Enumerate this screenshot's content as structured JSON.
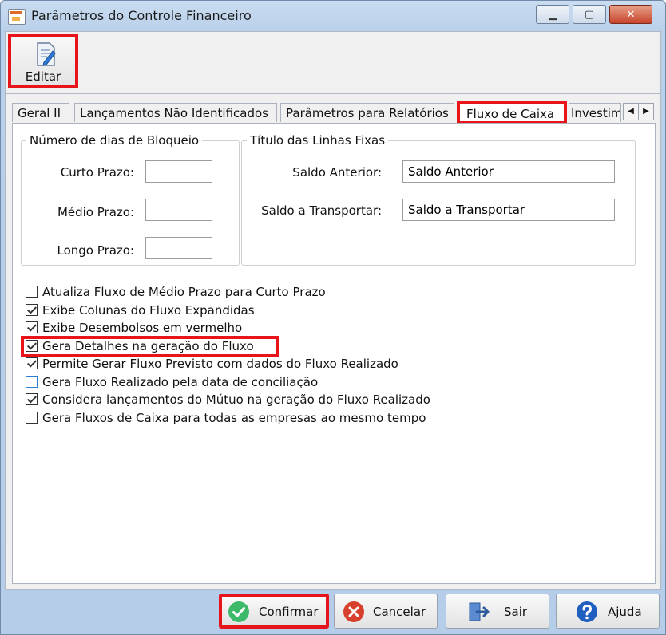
{
  "window": {
    "title": "Parâmetros do Controle Financeiro"
  },
  "toolbar": {
    "edit_label": "Editar"
  },
  "tabs": [
    {
      "label": "Geral II"
    },
    {
      "label": "Lançamentos Não Identificados"
    },
    {
      "label": "Parâmetros para Relatórios"
    },
    {
      "label": "Fluxo de Caixa",
      "active": true
    },
    {
      "label": "Investim"
    }
  ],
  "bloqueio": {
    "legend": "Número de dias de Bloqueio",
    "curto_label": "Curto Prazo:",
    "curto_value": "",
    "medio_label": "Médio Prazo:",
    "medio_value": "",
    "longo_label": "Longo Prazo:",
    "longo_value": ""
  },
  "linhas_fixas": {
    "legend": "Título das Linhas Fixas",
    "saldo_anterior_label": "Saldo Anterior:",
    "saldo_anterior_value": "Saldo Anterior",
    "saldo_transportar_label": "Saldo a Transportar:",
    "saldo_transportar_value": "Saldo a Transportar"
  },
  "checkboxes": [
    {
      "label": "Atualiza Fluxo de Médio Prazo para Curto Prazo",
      "checked": false
    },
    {
      "label": "Exibe Colunas do Fluxo Expandidas",
      "checked": true
    },
    {
      "label": "Exibe Desembolsos  em vermelho",
      "checked": true
    },
    {
      "label": "Gera Detalhes na geração do Fluxo",
      "checked": true
    },
    {
      "label": "Permite Gerar Fluxo Previsto com dados do Fluxo Realizado",
      "checked": true
    },
    {
      "label": "Gera Fluxo Realizado pela data de conciliação",
      "checked": false
    },
    {
      "label": "Considera lançamentos do Mútuo na geração do Fluxo Realizado",
      "checked": true
    },
    {
      "label": "Gera Fluxos de Caixa para todas as empresas ao mesmo tempo",
      "checked": false
    }
  ],
  "footer": {
    "confirm_label": "Confirmar",
    "cancel_label": "Cancelar",
    "exit_label": "Sair",
    "help_label": "Ajuda"
  },
  "colors": {
    "highlight": "#e8141c",
    "confirm_green": "#3db96a",
    "cancel_red": "#d8402e",
    "help_blue": "#1f5fbf"
  }
}
